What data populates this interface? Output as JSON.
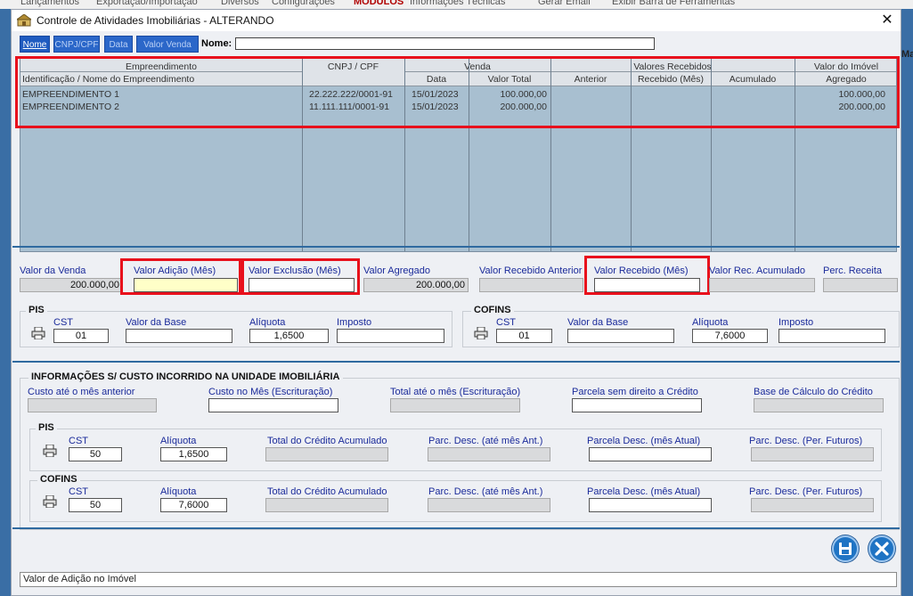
{
  "background": {
    "menu": [
      "Lançamentos",
      "Exportação/Importação",
      "Diversos",
      "Configurações",
      "MÓDULOS",
      "Informações Técnicas",
      "Gerar Email",
      "Exibir Barra de Ferramentas"
    ],
    "right_fragment": "Ma"
  },
  "window": {
    "title": "Controle de Atividades Imobiliárias  -  ALTERANDO",
    "close": "✕"
  },
  "search": {
    "tabs": [
      "Nome",
      "CNPJ/CPF",
      "Data",
      "Valor Venda"
    ],
    "label": "Nome:",
    "value": ""
  },
  "grid": {
    "groups": {
      "empreendimento": "Empreendimento",
      "cnpj": "CNPJ / CPF",
      "venda": "Venda",
      "valores": "Valores Recebidos",
      "valor_imovel": "Valor do Imóvel"
    },
    "columns": {
      "identificacao": "Identificação / Nome do  Empreendimento",
      "data": "Data",
      "valor_total": "Valor Total",
      "anterior": "Anterior",
      "recebido_mes": "Recebido (Mês)",
      "acumulado": "Acumulado",
      "agregado": "Agregado"
    },
    "rows": [
      {
        "nome": "EMPREENDIMENTO 1",
        "cnpj": "22.222.222/0001-91",
        "data": "15/01/2023",
        "valor_total": "100.000,00",
        "anterior": "",
        "recebido_mes": "",
        "acumulado": "",
        "agregado": "100.000,00"
      },
      {
        "nome": "EMPREENDIMENTO 2",
        "cnpj": "11.111.111/0001-91",
        "data": "15/01/2023",
        "valor_total": "200.000,00",
        "anterior": "",
        "recebido_mes": "",
        "acumulado": "",
        "agregado": "200.000,00"
      }
    ]
  },
  "values": {
    "valor_venda": {
      "label": "Valor da Venda",
      "value": "200.000,00"
    },
    "valor_adicao": {
      "label": "Valor Adição (Mês)",
      "value": ""
    },
    "valor_exclusao": {
      "label": "Valor Exclusão  (Mês)",
      "value": ""
    },
    "valor_agregado": {
      "label": "Valor Agregado",
      "value": "200.000,00"
    },
    "valor_recebido_anterior": {
      "label": "Valor Recebido Anterior",
      "value": ""
    },
    "valor_recebido_mes": {
      "label": "Valor Recebido (Mês)",
      "value": ""
    },
    "valor_rec_acumulado": {
      "label": "Valor Rec. Acumulado",
      "value": ""
    },
    "perc_receita": {
      "label": "Perc. Receita",
      "value": ""
    }
  },
  "pis": {
    "title": "PIS",
    "cst_label": "CST",
    "cst": "01",
    "base_label": "Valor da Base",
    "base": "",
    "aliquota_label": "Alíquota",
    "aliquota": "1,6500",
    "imposto_label": "Imposto",
    "imposto": ""
  },
  "cofins": {
    "title": "COFINS",
    "cst_label": "CST",
    "cst": "01",
    "base_label": "Valor da Base",
    "base": "",
    "aliquota_label": "Alíquota",
    "aliquota": "7,6000",
    "imposto_label": "Imposto",
    "imposto": ""
  },
  "custo": {
    "title": "INFORMAÇÕES S/ CUSTO INCORRIDO NA UNIDADE IMOBILIÁRIA",
    "custo_anterior": "Custo até o mês anterior",
    "custo_mes": "Custo no Mês (Escrituração)",
    "total_mes": "Total até o mês (Escrituração)",
    "parcela_sem_direito": "Parcela sem direito a Crédito",
    "base_calculo": "Base de Cálculo do Crédito",
    "pis": {
      "title": "PIS",
      "cst_label": "CST",
      "cst": "50",
      "aliquota_label": "Alíquota",
      "aliquota": "1,6500",
      "total_label": "Total do Crédito Acumulado",
      "parc_ant_label": "Parc. Desc. (até mês Ant.)",
      "parc_atual_label": "Parcela Desc. (mês Atual)",
      "parc_fut_label": "Parc. Desc. (Per. Futuros)"
    },
    "cofins": {
      "title": "COFINS",
      "cst_label": "CST",
      "cst": "50",
      "aliquota_label": "Alíquota",
      "aliquota": "7,6000",
      "total_label": "Total do Crédito Acumulado",
      "parc_ant_label": "Parc. Desc. (até mês Ant.)",
      "parc_atual_label": "Parcela Desc. (mês Atual)",
      "parc_fut_label": "Parc. Desc. (Per. Futuros)"
    }
  },
  "status": "Valor de Adição no Imóvel",
  "colors": {
    "tab_blue": "#2b67c9",
    "grid_body": "#a8bfd0",
    "highlight_red": "#e8101c",
    "button_blue": "#1f74c4"
  }
}
